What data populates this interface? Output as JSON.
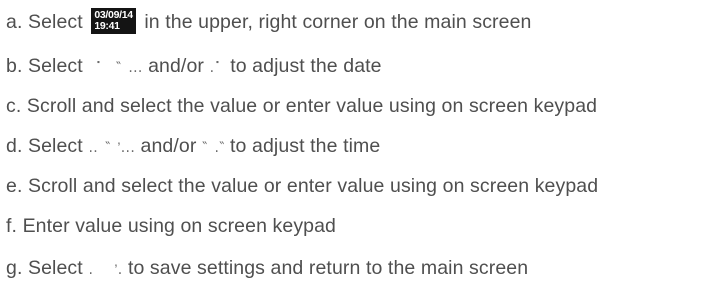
{
  "steps": [
    {
      "letter": "a.",
      "before": "Select",
      "badge_date": "03/09/14",
      "badge_time": "19:41",
      "after": "in the upper, right corner on the main screen"
    },
    {
      "letter": "b.",
      "before": "Select",
      "glyph1": " ⠁  ‶ ․․․",
      "middle": "and/or",
      "glyph2": "․⠁",
      "after": "to adjust the date"
    },
    {
      "letter": "c.",
      "text": "Scroll and select the value or enter value using on screen keypad"
    },
    {
      "letter": "d.",
      "before": "Select",
      "glyph1": "․․ ‶ ’․․․",
      "middle": "and/or",
      "glyph2": "‶ ․‶",
      "after": "to adjust the time"
    },
    {
      "letter": "e.",
      "text": "Scroll and select the value or enter value using on screen keypad"
    },
    {
      "letter": "f.",
      "text": "Enter value using on screen keypad"
    },
    {
      "letter": "g.",
      "before": "Select",
      "glyph1": "․   ’․",
      "after": "to save settings and return to the main screen"
    }
  ]
}
